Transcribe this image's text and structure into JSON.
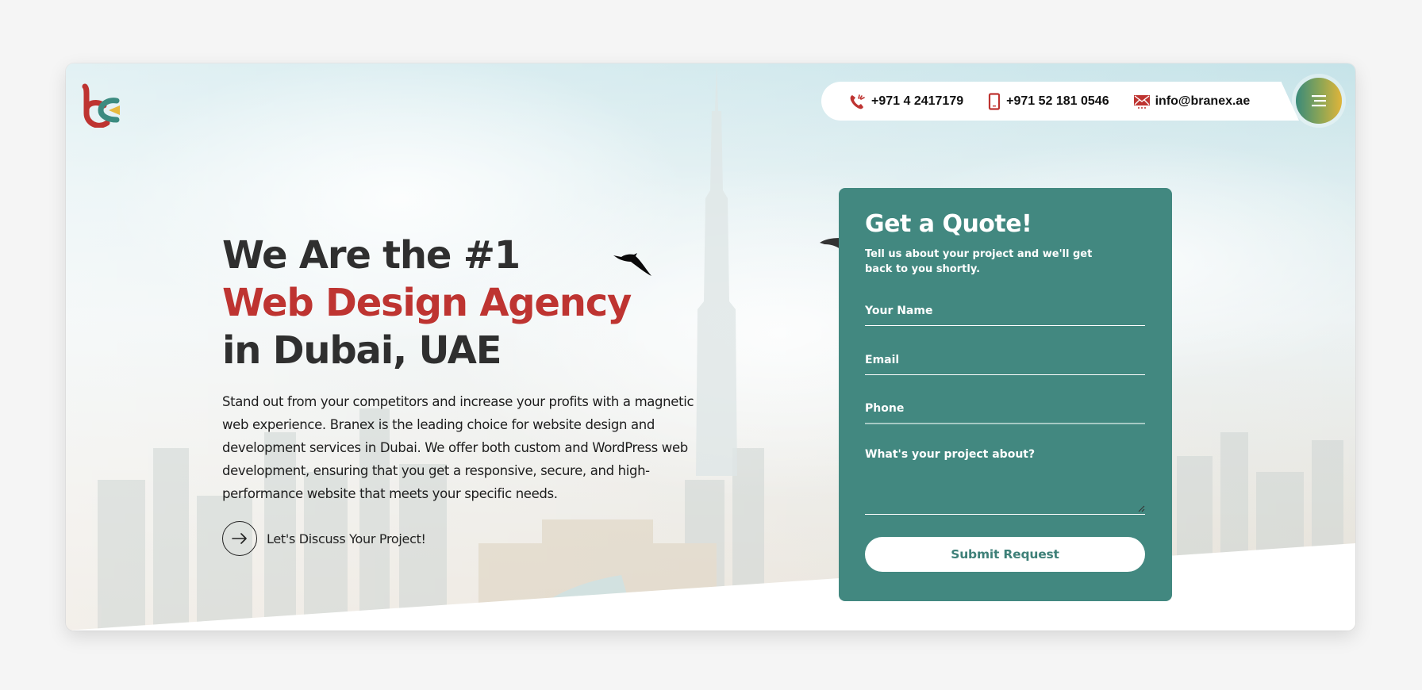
{
  "brand": {
    "logo_name": "Branex",
    "colors": {
      "red": "#be3431",
      "teal": "#428880",
      "yellow": "#e8b93e",
      "text_dark": "#2f2f2f"
    }
  },
  "header": {
    "contacts": [
      {
        "icon": "phone-call-icon",
        "label": "+971 4 2417179"
      },
      {
        "icon": "mobile-phone-icon",
        "label": "+971 52 181 0546"
      },
      {
        "icon": "email-icon",
        "label": "info@branex.ae"
      }
    ],
    "menu_icon": "hamburger-menu-icon"
  },
  "hero": {
    "headline_line1": "We Are the #1",
    "headline_line2": "Web Design Agency",
    "headline_line3": "in Dubai, UAE",
    "description": "Stand out from your competitors and increase your profits with a magnetic web experience. Branex is the leading choice for website design and development services in Dubai. We offer both custom and WordPress web development, ensuring that you get a responsive, secure, and high-performance website that meets your specific needs.",
    "cta_label": "Let's Discuss Your Project!",
    "cta_icon": "arrow-right-icon"
  },
  "quote_form": {
    "title": "Get a Quote!",
    "subtitle": "Tell us about your project and we'll get back to you shortly.",
    "fields": {
      "name_placeholder": "Your Name",
      "email_placeholder": "Email",
      "phone_placeholder": "Phone",
      "project_placeholder": "What's your project about?"
    },
    "submit_label": "Submit Request"
  }
}
